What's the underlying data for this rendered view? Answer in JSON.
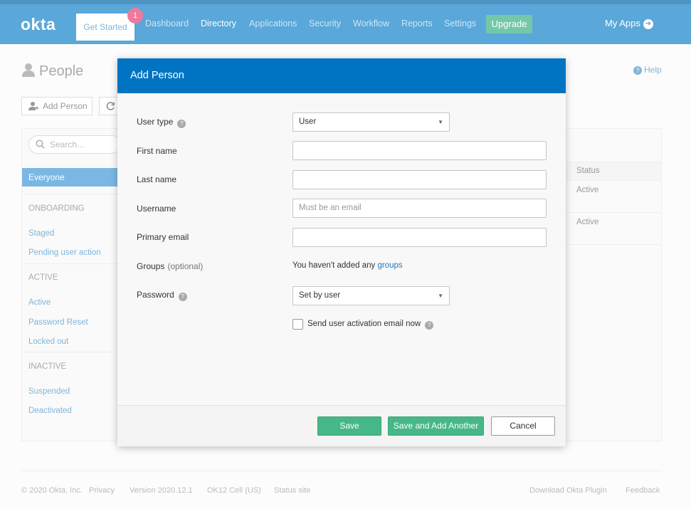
{
  "topnav": {
    "logo": "okta",
    "get_started": "Get Started",
    "badge_count": "1",
    "links": [
      "Dashboard",
      "Directory",
      "Applications",
      "Security",
      "Workflow",
      "Reports",
      "Settings"
    ],
    "upgrade": "Upgrade",
    "my_apps": "My Apps"
  },
  "page": {
    "title": "People",
    "help": "Help",
    "add_person_button": "Add Person",
    "search_placeholder": "Search...",
    "sidebar": {
      "everyone": "Everyone",
      "onboarding_heading": "ONBOARDING",
      "staged": "Staged",
      "pending": "Pending user action",
      "active_heading": "ACTIVE",
      "active": "Active",
      "password_reset": "Password Reset",
      "locked_out": "Locked out",
      "inactive_heading": "INACTIVE",
      "suspended": "Suspended",
      "deactivated": "Deactivated"
    },
    "table": {
      "status_header": "Status",
      "rows": [
        "Active",
        "Active"
      ]
    }
  },
  "footer": {
    "copyright": "© 2020 Okta, Inc.",
    "privacy": "Privacy",
    "version": "Version 2020.12.1",
    "cell": "OK12 Cell (US)",
    "status_site": "Status site",
    "download_plugin": "Download Okta Plugin",
    "feedback": "Feedback"
  },
  "modal": {
    "title": "Add Person",
    "labels": {
      "user_type": "User type",
      "first_name": "First name",
      "last_name": "Last name",
      "username": "Username",
      "primary_email": "Primary email",
      "groups": "Groups",
      "groups_optional": "(optional)",
      "password": "Password"
    },
    "user_type_value": "User",
    "first_name_value": "",
    "last_name_value": "",
    "username_placeholder": "Must be an email",
    "primary_email_value": "",
    "groups_text": "You haven't added any",
    "groups_link": "groups",
    "password_value": "Set by user",
    "send_activation_label": "Send user activation email now",
    "send_activation_checked": false,
    "buttons": {
      "save": "Save",
      "save_add_another": "Save and Add Another",
      "cancel": "Cancel"
    }
  }
}
